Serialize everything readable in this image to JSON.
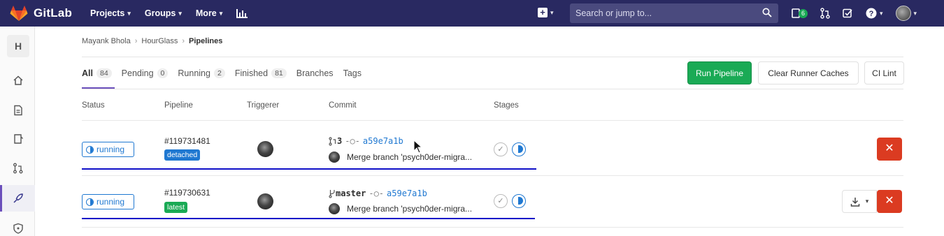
{
  "topbar": {
    "brand": "GitLab",
    "nav": [
      {
        "label": "Projects"
      },
      {
        "label": "Groups"
      },
      {
        "label": "More"
      }
    ],
    "search_placeholder": "Search or jump to...",
    "todo_count": "6"
  },
  "sidebar": {
    "project_initial": "H"
  },
  "breadcrumb": {
    "items": [
      "Mayank Bhola",
      "HourGlass",
      "Pipelines"
    ]
  },
  "tabs": [
    {
      "label": "All",
      "count": "84"
    },
    {
      "label": "Pending",
      "count": "0"
    },
    {
      "label": "Running",
      "count": "2"
    },
    {
      "label": "Finished",
      "count": "81"
    },
    {
      "label": "Branches",
      "count": ""
    },
    {
      "label": "Tags",
      "count": ""
    }
  ],
  "actions": {
    "run_pipeline": "Run Pipeline",
    "clear_caches": "Clear Runner Caches",
    "ci_lint": "CI Lint"
  },
  "table": {
    "headers": [
      "Status",
      "Pipeline",
      "Triggerer",
      "Commit",
      "Stages"
    ],
    "rows": [
      {
        "status": "running",
        "pipeline_id": "#119731481",
        "label": "detached",
        "ref": "3",
        "sha": "a59e7a1b",
        "commit_title": "Merge branch 'psych0der-migra..."
      },
      {
        "status": "running",
        "pipeline_id": "#119730631",
        "label": "latest",
        "ref": "master",
        "sha": "a59e7a1b",
        "commit_title": "Merge branch 'psych0der-migra..."
      }
    ]
  },
  "colors": {
    "topbar": "#292961",
    "running": "#1f78d1",
    "success": "#1aaa55",
    "danger": "#db3b21"
  }
}
